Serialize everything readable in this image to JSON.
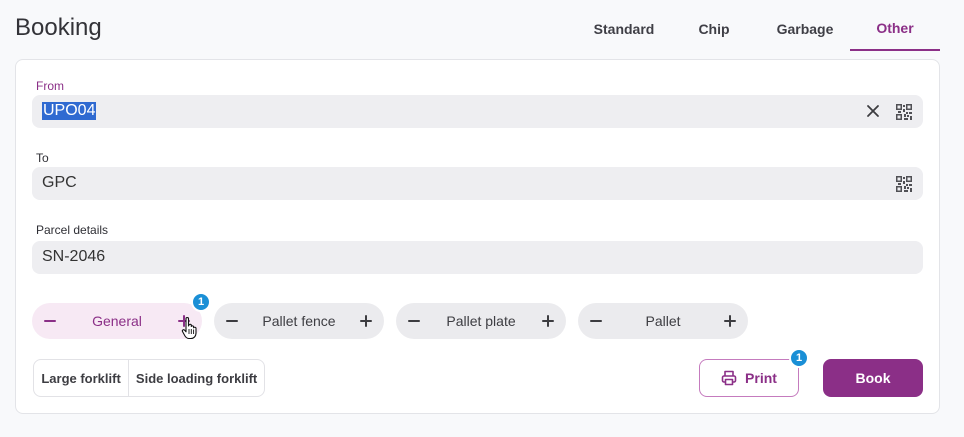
{
  "page": {
    "title": "Booking"
  },
  "tabs": [
    {
      "label": "Standard",
      "active": false
    },
    {
      "label": "Chip",
      "active": false
    },
    {
      "label": "Garbage",
      "active": false
    },
    {
      "label": "Other",
      "active": true
    }
  ],
  "form": {
    "from": {
      "label": "From",
      "value": "UPO04",
      "selected": true
    },
    "to": {
      "label": "To",
      "value": "GPC"
    },
    "parcel": {
      "label": "Parcel details",
      "value": "SN-2046"
    }
  },
  "steppers": [
    {
      "label": "General",
      "count": "1",
      "active": true
    },
    {
      "label": "Pallet fence"
    },
    {
      "label": "Pallet plate"
    },
    {
      "label": "Pallet"
    }
  ],
  "equipment": [
    "Large forklift",
    "Side loading forklift"
  ],
  "actions": {
    "print_label": "Print",
    "print_badge": "1",
    "book_label": "Book"
  },
  "icons": {
    "clear": "close-icon",
    "scan": "qr-code-icon",
    "print": "printer-icon",
    "minus": "minus-icon",
    "plus": "plus-icon",
    "cursor": "hand-pointer-icon"
  },
  "colors": {
    "accent": "#8b2f87",
    "badge": "#1a8fd6",
    "field_bg": "#eeeef1",
    "selection": "#2f6ad1"
  }
}
